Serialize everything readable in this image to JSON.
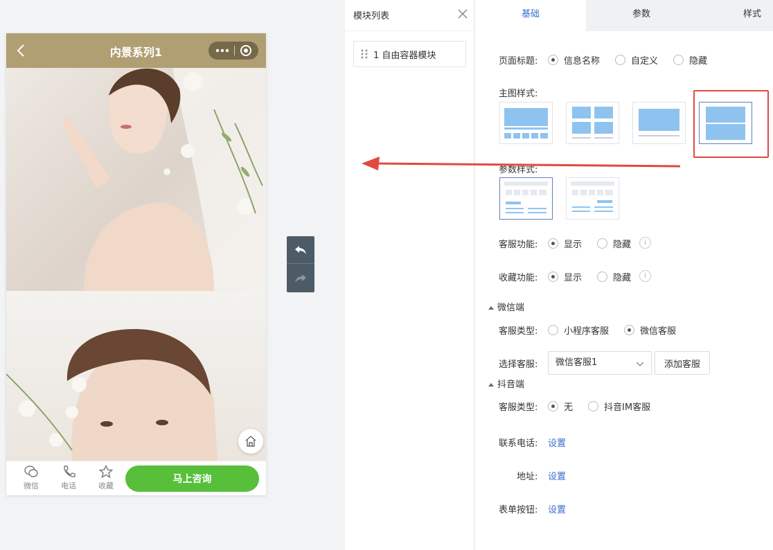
{
  "phone": {
    "title": "内景系列1",
    "bottom": {
      "wechat": "微信",
      "phone": "电话",
      "favorite": "收藏",
      "consult": "马上咨询"
    }
  },
  "module_panel": {
    "title": "模块列表",
    "item": "1 自由容器模块"
  },
  "tabs": [
    "基础",
    "参数",
    "样式"
  ],
  "form": {
    "page_title": {
      "label": "页面标题:",
      "options": [
        "信息名称",
        "自定义",
        "隐藏"
      ],
      "selected": 0
    },
    "main_style": {
      "label": "主图样式:",
      "selected": 3
    },
    "param_style": {
      "label": "参数样式:",
      "selected": 0
    },
    "service": {
      "label": "客服功能:",
      "options": [
        "显示",
        "隐藏"
      ],
      "selected": 0
    },
    "favorite": {
      "label": "收藏功能:",
      "options": [
        "显示",
        "隐藏"
      ],
      "selected": 0
    },
    "wechat_section": "微信端",
    "wechat_service_type": {
      "label": "客服类型:",
      "options": [
        "小程序客服",
        "微信客服"
      ],
      "selected": 1
    },
    "select_service": {
      "label": "选择客服:",
      "value": "微信客服1",
      "add_button": "添加客服"
    },
    "douyin_section": "抖音端",
    "douyin_service_type": {
      "label": "客服类型:",
      "options": [
        "无",
        "抖音IM客服"
      ],
      "selected": 0
    },
    "contact_phone": {
      "label": "联系电话:",
      "link": "设置"
    },
    "address": {
      "label": "地址:",
      "link": "设置"
    },
    "form_button": {
      "label": "表单按钮:",
      "link": "设置"
    }
  },
  "colors": {
    "header": "#b19f74",
    "consult": "#57bf3a",
    "accent": "#3a6ecf",
    "highlight": "#e04a3f"
  }
}
